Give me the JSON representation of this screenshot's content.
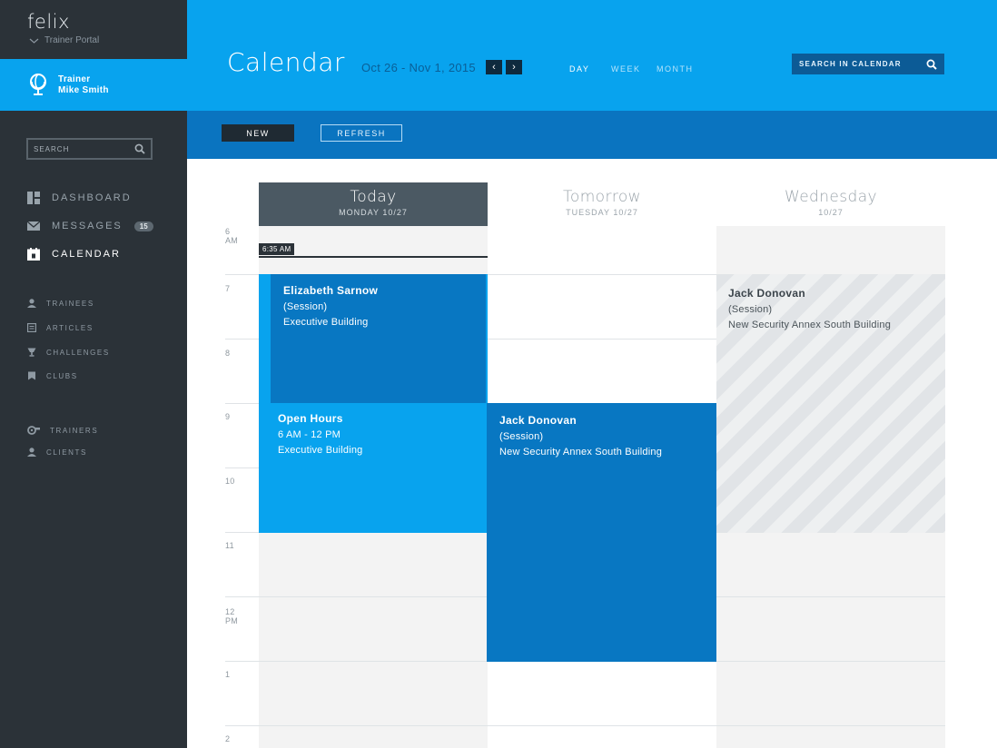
{
  "app": {
    "name": "felix",
    "portal": "Trainer Portal"
  },
  "trainer": {
    "role": "Trainer",
    "name": "Mike Smith"
  },
  "sidebar": {
    "search_placeholder": "SEARCH",
    "main_nav": [
      {
        "label": "DASHBOARD",
        "icon": "dashboard-icon"
      },
      {
        "label": "MESSAGES",
        "icon": "envelope-icon",
        "badge": "15"
      },
      {
        "label": "CALENDAR",
        "icon": "calendar-icon",
        "active": true
      }
    ],
    "content_nav": [
      {
        "label": "TRAINEES",
        "icon": "person-icon"
      },
      {
        "label": "ARTICLES",
        "icon": "article-icon"
      },
      {
        "label": "CHALLENGES",
        "icon": "trophy-icon"
      },
      {
        "label": "CLUBS",
        "icon": "flag-icon"
      }
    ],
    "people_nav": [
      {
        "label": "TRAINERS",
        "icon": "whistle-icon"
      },
      {
        "label": "CLIENTS",
        "icon": "person-icon"
      }
    ]
  },
  "header": {
    "title": "Calendar",
    "date_range": "Oct 26 - Nov 1, 2015",
    "prev_label": "‹",
    "next_label": "›",
    "views": [
      "DAY",
      "WEEK",
      "MONTH"
    ],
    "active_view": "DAY",
    "search_placeholder": "SEARCH IN CALENDAR"
  },
  "toolbar": {
    "new_label": "NEW",
    "refresh_label": "REFRESH"
  },
  "calendar": {
    "days": [
      {
        "name": "Today",
        "date": "MONDAY 10/27",
        "is_today": true
      },
      {
        "name": "Tomorrow",
        "date": "TUESDAY 10/27"
      },
      {
        "name": "Wednesday",
        "date": "10/27"
      }
    ],
    "hours": [
      {
        "num": "6",
        "ampm": "AM"
      },
      {
        "num": "7",
        "ampm": ""
      },
      {
        "num": "8",
        "ampm": ""
      },
      {
        "num": "9",
        "ampm": ""
      },
      {
        "num": "10",
        "ampm": ""
      },
      {
        "num": "11",
        "ampm": ""
      },
      {
        "num": "12",
        "ampm": "PM"
      },
      {
        "num": "1",
        "ampm": ""
      },
      {
        "num": "2",
        "ampm": ""
      }
    ],
    "now_label": "6:35 AM",
    "events": [
      {
        "title": "Open Hours",
        "line1": "6 AM - 12 PM",
        "line2": "Executive Building",
        "style": "light"
      },
      {
        "title": "Elizabeth Sarnow",
        "line1": "(Session)",
        "line2": "Executive Building",
        "style": "dark"
      },
      {
        "title": "Jack Donovan",
        "line1": "(Session)",
        "line2": "New Security Annex South Building",
        "style": "dark"
      },
      {
        "title": "Jack Donovan",
        "line1": "(Session)",
        "line2": "New Security Annex South Building",
        "style": "striped"
      }
    ]
  },
  "colors": {
    "accent": "#08a3ee",
    "accent_dark": "#0a74c0",
    "event_dark": "#0877c2",
    "sidebar": "#2b3238"
  }
}
